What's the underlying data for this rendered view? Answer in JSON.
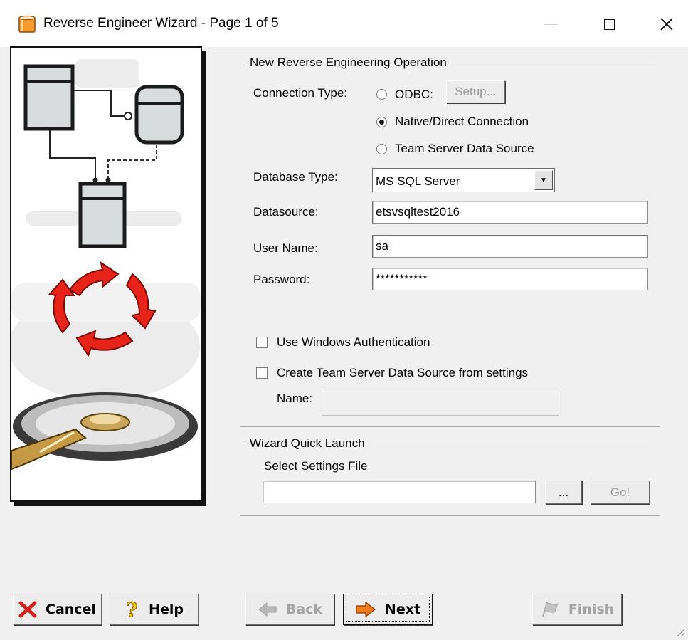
{
  "window": {
    "title": "Reverse Engineer Wizard - Page 1 of 5",
    "icon": "database-cylinder-icon",
    "controls": [
      "minimize-icon",
      "maximize-icon",
      "close-icon"
    ]
  },
  "illustration": {
    "icons": [
      "database-schema-diagram",
      "refresh-arrows",
      "hard-disk"
    ]
  },
  "operation_group": {
    "title": "New Reverse Engineering Operation",
    "connection_type_label": "Connection Type:",
    "options": [
      {
        "label": "ODBC:",
        "selected": false
      },
      {
        "label": "Native/Direct Connection",
        "selected": true
      },
      {
        "label": "Team Server Data Source",
        "selected": false
      }
    ],
    "setup_button": "Setup...",
    "database_type_label": "Database Type:",
    "database_type_value": "MS SQL Server",
    "datasource_label": "Datasource:",
    "datasource_value": "etsvsqltest2016",
    "username_label": "User Name:",
    "username_value": "sa",
    "password_label": "Password:",
    "password_value": "***********",
    "use_windows_auth_label": "Use Windows Authentication",
    "use_windows_auth_checked": false,
    "create_team_server_label": "Create Team Server Data Source from settings",
    "create_team_server_checked": false,
    "name_label": "Name:",
    "name_value": ""
  },
  "quick_launch": {
    "title": "Wizard Quick Launch",
    "select_settings_label": "Select Settings File",
    "settings_file_value": "",
    "browse_button": "...",
    "go_button": "Go!"
  },
  "buttons": {
    "cancel": "Cancel",
    "help": "Help",
    "back": "Back",
    "next": "Next",
    "finish": "Finish"
  },
  "colors": {
    "accent_red": "#e8231a",
    "next_arrow": "#f07c1d",
    "cancel_x": "#d21f1a"
  }
}
